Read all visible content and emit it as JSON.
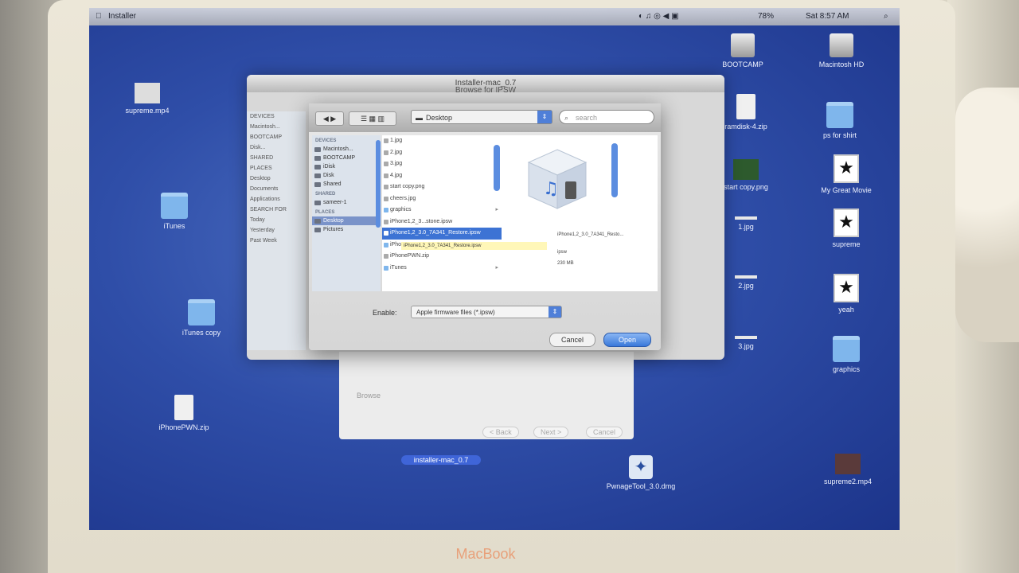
{
  "menubar": {
    "app_title": "Installer",
    "clock": "Sat 8:57 AM",
    "battery": "78%"
  },
  "desktop_icons": [
    {
      "label": "supreme.mp4",
      "kind": "image"
    },
    {
      "label": "iTunes",
      "kind": "folder"
    },
    {
      "label": "iTunes copy",
      "kind": "folder"
    },
    {
      "label": "iPhonePWN.zip",
      "kind": "doc"
    },
    {
      "label": "BOOTCAMP",
      "kind": "drive"
    },
    {
      "label": "Macintosh HD",
      "kind": "drive"
    },
    {
      "label": "ramdisk-4.zip",
      "kind": "doc"
    },
    {
      "label": "ps for shirt",
      "kind": "folder"
    },
    {
      "label": "start copy.png",
      "kind": "image"
    },
    {
      "label": "My Great Movie",
      "kind": "film"
    },
    {
      "label": "supreme",
      "kind": "film"
    },
    {
      "label": "1.jpg",
      "kind": "line"
    },
    {
      "label": "2.jpg",
      "kind": "line"
    },
    {
      "label": "3.jpg",
      "kind": "line"
    },
    {
      "label": "yeah",
      "kind": "film"
    },
    {
      "label": "graphics",
      "kind": "folder"
    },
    {
      "label": "PwnageTool_3.0.dmg",
      "kind": "app"
    },
    {
      "label": "supreme2.mp4",
      "kind": "image"
    }
  ],
  "back_window": {
    "title": "Installer-mac_0.7",
    "subtitle": "Browse for IPSW",
    "sidebar_items": [
      "DEVICES",
      "Macintosh...",
      "BOOTCAMP",
      "Disk...",
      "SHARED",
      "PLACES",
      "Desktop",
      "Documents",
      "Applications",
      "SEARCH FOR",
      "Today",
      "Yesterday",
      "Past Week"
    ],
    "under_browse": "Browse",
    "under_buttons": [
      "< Back",
      "Next >",
      "Cancel"
    ]
  },
  "taskbar_label": "installer-mac_0.7",
  "dialog": {
    "location": "Desktop",
    "search_placeholder": "search",
    "sidebar": {
      "devices_header": "DEVICES",
      "devices": [
        "Macintosh...",
        "BOOTCAMP",
        "iDisk",
        "Disk",
        "Shared"
      ],
      "shared_header": "SHARED",
      "shared": [
        "sameer-1"
      ],
      "places_header": "PLACES",
      "places": [
        "Desktop",
        "Pictures"
      ]
    },
    "files": [
      {
        "name": "1.jpg",
        "selected": false
      },
      {
        "name": "2.jpg",
        "selected": false
      },
      {
        "name": "3.jpg",
        "selected": false
      },
      {
        "name": "4.jpg",
        "selected": false
      },
      {
        "name": "start copy.png",
        "selected": false
      },
      {
        "name": "cheers.jpg",
        "selected": false
      },
      {
        "name": "graphics",
        "selected": false
      },
      {
        "name": "iPhone1,2_3...stone.ipsw",
        "selected": false
      },
      {
        "name": "iPhone1,2_3.0_7A341_Restore.ipsw",
        "selected": true
      },
      {
        "name": "iPhonePWN",
        "selected": false
      },
      {
        "name": "iPhonePWN.zip",
        "selected": false
      },
      {
        "name": "iTunes",
        "selected": false
      }
    ],
    "tooltip": "iPhone1,2_3.0_7A341_Restore.ipsw",
    "preview": {
      "name": "iPhone1,2_3.0_7A341_Resto...",
      "kind": "ipsw",
      "size": "230 MB"
    },
    "enable_label": "Enable:",
    "enable_value": "Apple firmware files (*.ipsw)",
    "cancel_label": "Cancel",
    "open_label": "Open"
  },
  "bezel_brand": "MacBook",
  "colors": {
    "accent": "#3d73d4",
    "desktop": "#2f4ea8"
  }
}
